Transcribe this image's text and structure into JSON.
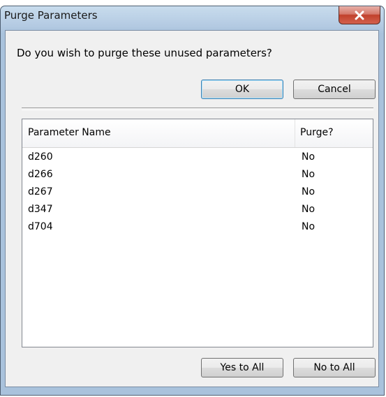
{
  "window": {
    "title": "Purge Parameters",
    "close_icon": "close-icon"
  },
  "dialog": {
    "question": "Do you wish to purge these unused parameters?",
    "ok_label": "OK",
    "cancel_label": "Cancel",
    "yes_to_all_label": "Yes to All",
    "no_to_all_label": "No to All"
  },
  "table": {
    "columns": [
      "Parameter Name",
      "Purge?"
    ],
    "rows": [
      {
        "name": "d260",
        "purge": "No"
      },
      {
        "name": "d266",
        "purge": "No"
      },
      {
        "name": "d267",
        "purge": "No"
      },
      {
        "name": "d347",
        "purge": "No"
      },
      {
        "name": "d704",
        "purge": "No"
      }
    ]
  }
}
